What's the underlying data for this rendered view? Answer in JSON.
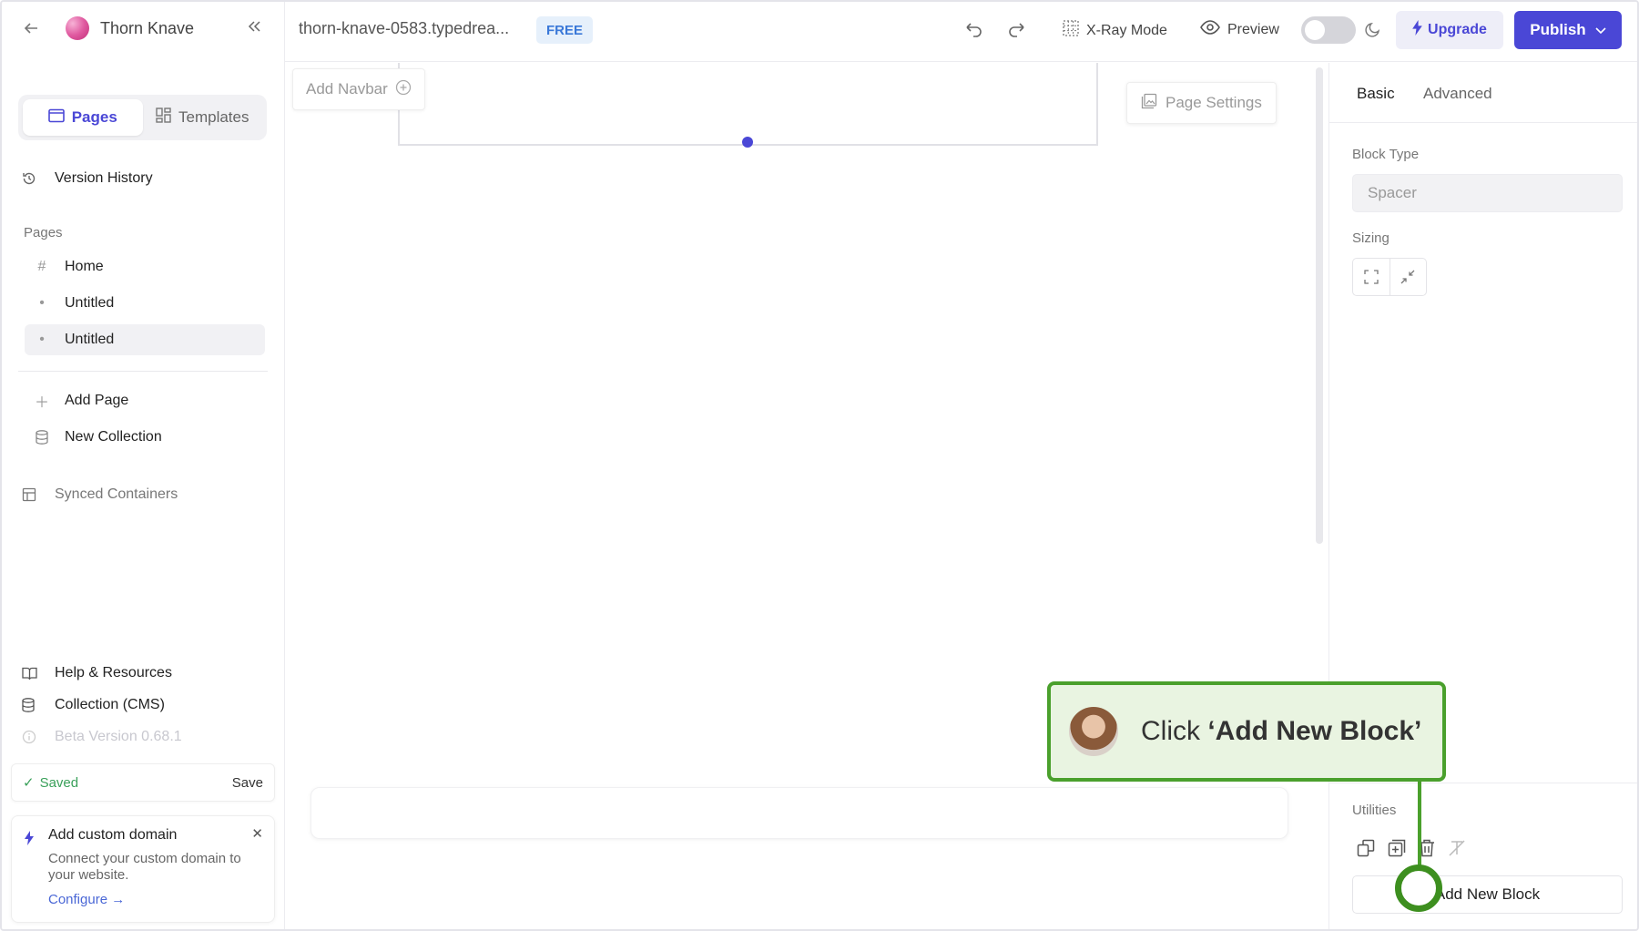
{
  "sidebar": {
    "site_name": "Thorn Knave",
    "tabs": [
      {
        "label": "Pages"
      },
      {
        "label": "Templates"
      }
    ],
    "version_history": "Version History",
    "pages_section": "Pages",
    "pages": [
      {
        "label": "Home",
        "icon": "hash-icon"
      },
      {
        "label": "Untitled",
        "icon": "dot-icon"
      },
      {
        "label": "Untitled",
        "icon": "dot-icon",
        "active": true
      }
    ],
    "add_page": "Add Page",
    "new_collection": "New Collection",
    "synced_containers": "Synced Containers",
    "help": "Help & Resources",
    "cms": "Collection (CMS)",
    "beta_version": "Beta Version 0.68.1",
    "saved_status": "Saved",
    "save_label": "Save",
    "domain_card": {
      "title": "Add custom domain",
      "description": "Connect your custom domain to your website.",
      "cta": "Configure →"
    }
  },
  "topbar": {
    "domain": "thorn-knave-0583.typedrea...",
    "plan_badge": "FREE",
    "xray": "X-Ray Mode",
    "preview": "Preview",
    "upgrade": "Upgrade",
    "publish": "Publish"
  },
  "canvas": {
    "add_navbar": "Add Navbar",
    "page_settings": "Page Settings"
  },
  "right_panel": {
    "tabs": [
      {
        "label": "Basic",
        "active": true
      },
      {
        "label": "Advanced"
      }
    ],
    "block_type_label": "Block Type",
    "block_type_value": "Spacer",
    "sizing_label": "Sizing",
    "utilities_label": "Utilities",
    "add_new_block": "Add New Block"
  },
  "tutorial": {
    "prefix": "Click ",
    "target": "‘Add New Block’"
  },
  "colors": {
    "accent": "#4a47d6",
    "success": "#3aa05a",
    "tutorial_green": "#4aa02c"
  }
}
